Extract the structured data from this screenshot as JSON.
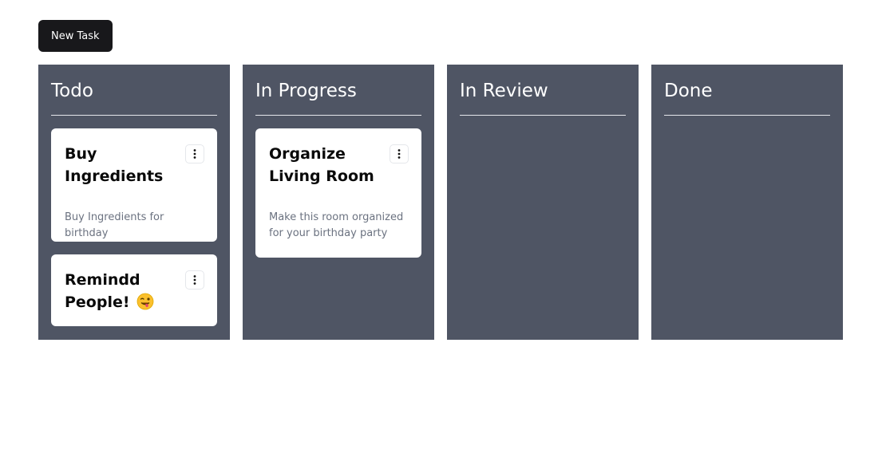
{
  "toolbar": {
    "new_task_label": "New Task"
  },
  "columns": [
    {
      "title": "Todo",
      "cards": [
        {
          "title": "Buy Ingredients",
          "description": "Buy Ingredients for birthday"
        },
        {
          "title": "Remindd People!",
          "emoji": "face-with-tongue-wink"
        }
      ]
    },
    {
      "title": "In Progress",
      "cards": [
        {
          "title": "Organize Living Room",
          "description": "Make this room organized for your birthday party"
        }
      ]
    },
    {
      "title": "In Review",
      "cards": []
    },
    {
      "title": "Done",
      "cards": []
    }
  ],
  "colors": {
    "column_bg": "#4f5564",
    "button_bg": "#18181b",
    "card_bg": "#ffffff",
    "description_text": "#6b7280"
  },
  "icons": {
    "card_menu": "more-vertical-icon"
  }
}
